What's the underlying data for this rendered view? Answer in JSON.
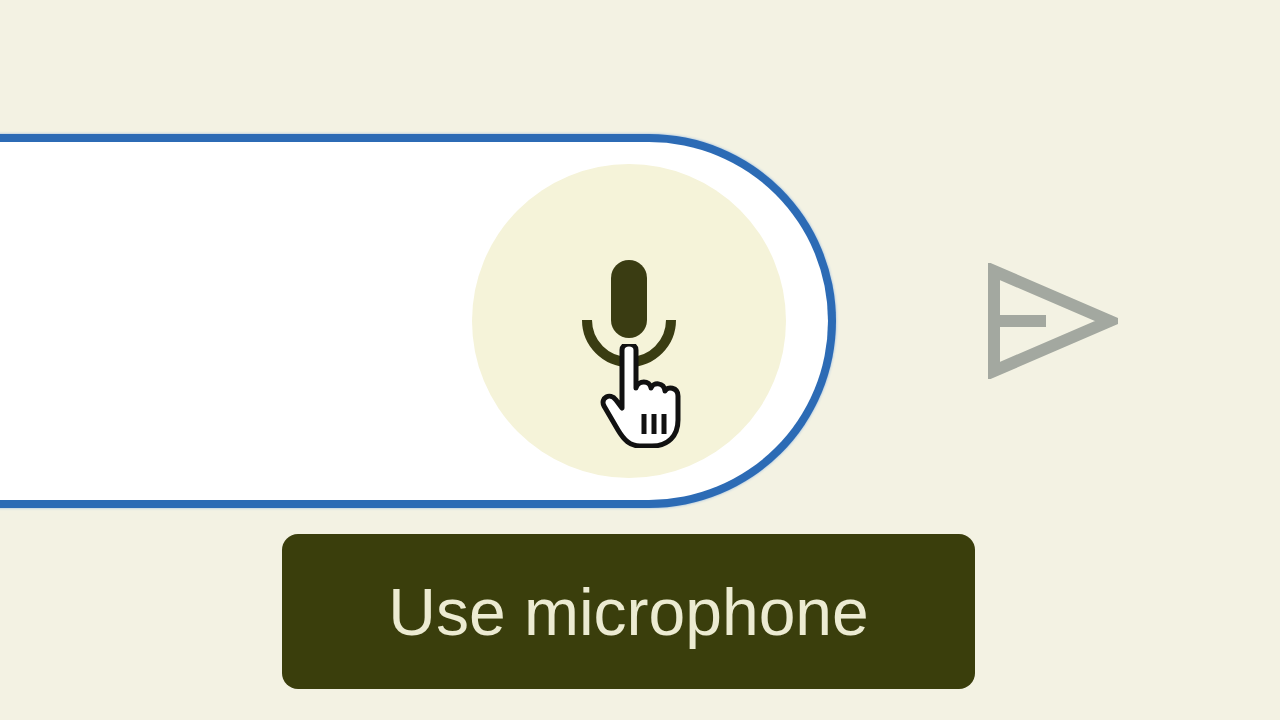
{
  "message_field": {
    "focused": true
  },
  "mic_button": {
    "hovered": true
  },
  "send_button": {
    "disabled": true
  },
  "tooltip": {
    "text": "Use microphone"
  }
}
